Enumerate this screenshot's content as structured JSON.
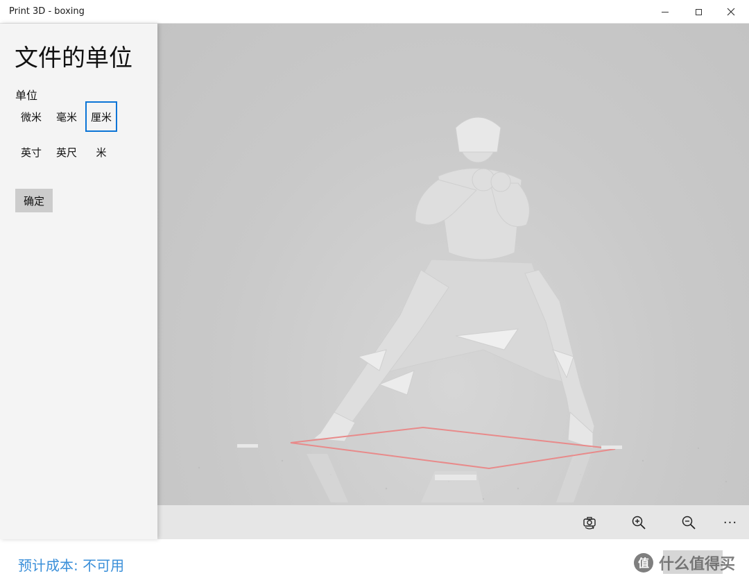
{
  "window": {
    "title": "Print 3D - boxing",
    "controls": [
      "minimize-icon",
      "maximize-icon",
      "close-icon"
    ]
  },
  "panel": {
    "title": "文件的单位",
    "unit_label": "单位",
    "units": [
      {
        "label": "微米",
        "selected": false
      },
      {
        "label": "毫米",
        "selected": false
      },
      {
        "label": "厘米",
        "selected": true
      },
      {
        "label": "英寸",
        "selected": false
      },
      {
        "label": "英尺",
        "selected": false
      },
      {
        "label": "米",
        "selected": false
      }
    ],
    "confirm_label": "确定"
  },
  "toolbar": {
    "icons": [
      "rotate-camera-icon",
      "zoom-in-icon",
      "zoom-out-icon",
      "more-icon"
    ],
    "more_glyph": "···"
  },
  "footer": {
    "cost_text": "预计成本: 不可用",
    "print_label": "",
    "watermark_text": "什么值得买"
  },
  "colors": {
    "accent": "#0a74d6",
    "cost_text": "#3a8fd9",
    "build_plate_outline": "#e88a8a"
  }
}
